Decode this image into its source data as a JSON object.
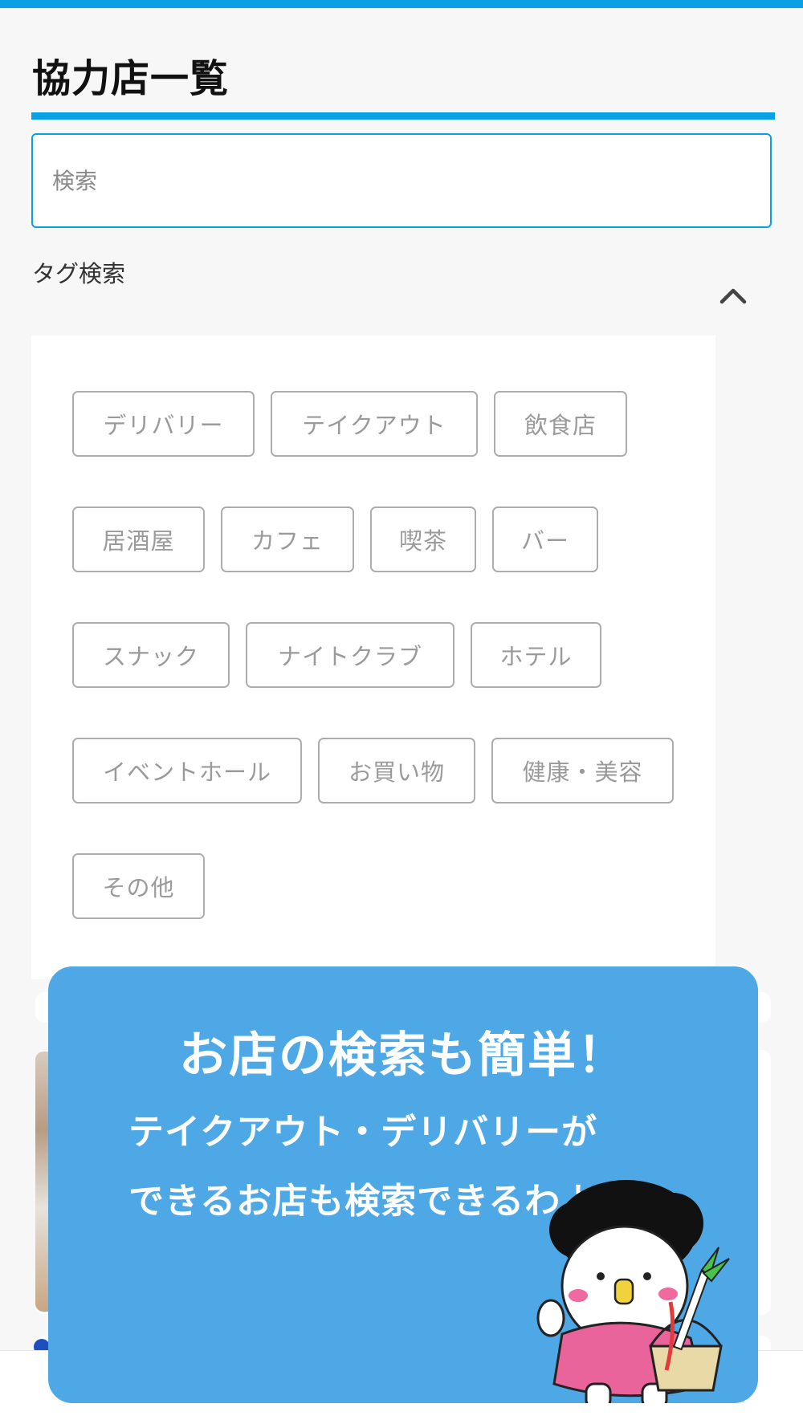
{
  "page": {
    "title": "協力店一覧",
    "accent_color": "#0aa0e6"
  },
  "search": {
    "placeholder": "検索",
    "value": ""
  },
  "tag_search": {
    "label": "タグ検索",
    "toggle_icon": "chevron-up-icon",
    "tags": [
      "デリバリー",
      "テイクアウト",
      "飲食店",
      "居酒屋",
      "カフェ",
      "喫茶",
      "バー",
      "スナック",
      "ナイトクラブ",
      "ホテル",
      "イベントホール",
      "お買い物",
      "健康・美容",
      "その他"
    ]
  },
  "promo": {
    "headline": "お店の検索も簡単！",
    "line1": "テイクアウト・デリバリーが",
    "line2": "できるお店も検索できるわよっ！",
    "background_color": "#4ea8e6",
    "mascot": "mascot-character-icon"
  }
}
